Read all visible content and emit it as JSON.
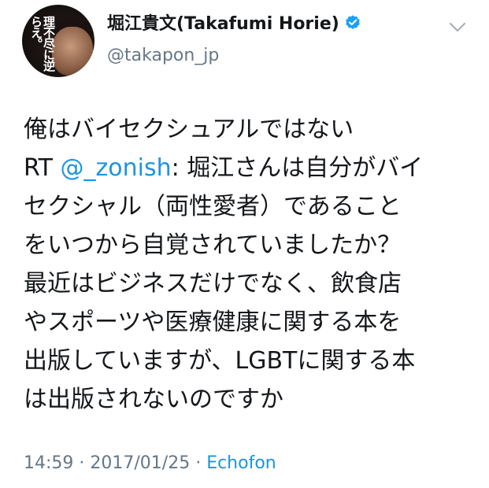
{
  "tweet": {
    "avatar": {
      "cover_text": "理不尽に逆らえ。"
    },
    "author": {
      "display_name": "堀江貴文(Takafumi Horie)",
      "handle": "@takapon_jp",
      "verified": true
    },
    "menu_icon": "chevron-down-icon",
    "body": {
      "line1": "俺はバイセクシュアルではない",
      "line2_prefix": "RT ",
      "line2_mention": "@_zonish",
      "line2_suffix": ": 堀江さんは自分がバイ",
      "line3": "セクシャル（両性愛者）であること",
      "line4": "をいつから自覚されていましたか？",
      "line5": "最近はビジネスだけでなく、飲食店",
      "line6": "やスポーツや医療健康に関する本を",
      "line7": "出版していますが、LGBTに関する本",
      "line8": "は出版されないのですか"
    },
    "meta": {
      "time": "14:59",
      "separator": " · ",
      "date": "2017/01/25",
      "source": "Echofon"
    },
    "colors": {
      "text": "#14171a",
      "secondary": "#657786",
      "link": "#1b95e0",
      "verified": "#1da1f2"
    }
  }
}
